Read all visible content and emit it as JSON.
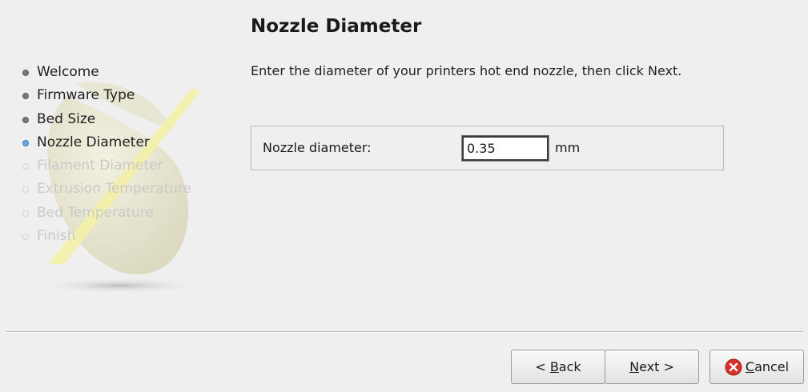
{
  "page": {
    "title": "Nozzle Diameter",
    "description": "Enter the diameter of your printers hot end nozzle, then click Next."
  },
  "steps": [
    {
      "label": "Welcome",
      "state": "done"
    },
    {
      "label": "Firmware Type",
      "state": "done"
    },
    {
      "label": "Bed Size",
      "state": "done"
    },
    {
      "label": "Nozzle Diameter",
      "state": "current"
    },
    {
      "label": "Filament Diameter",
      "state": "pending"
    },
    {
      "label": "Extrusion Temperature",
      "state": "pending"
    },
    {
      "label": "Bed Temperature",
      "state": "pending"
    },
    {
      "label": "Finish",
      "state": "pending"
    }
  ],
  "field": {
    "label": "Nozzle diameter:",
    "value": "0.35",
    "unit": "mm"
  },
  "buttons": {
    "back": {
      "prefix": "< ",
      "mnemonic": "B",
      "rest": "ack"
    },
    "next": {
      "mnemonic": "N",
      "rest": "ext >"
    },
    "cancel": {
      "mnemonic": "C",
      "rest": "ancel",
      "icon": "cancel-icon"
    }
  },
  "colors": {
    "background": "#efefef",
    "current_step_bullet": "#6fa8dc",
    "cancel_icon": "#d9302a"
  }
}
